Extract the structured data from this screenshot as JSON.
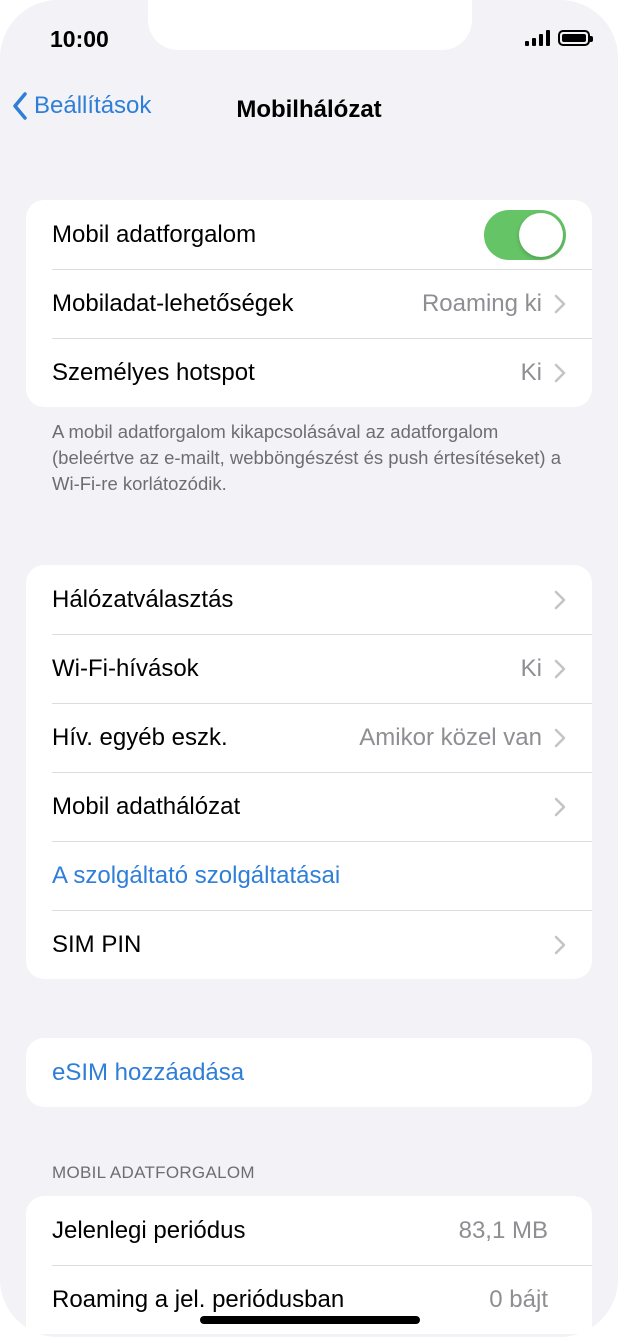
{
  "status_bar": {
    "time": "10:00"
  },
  "nav": {
    "back_label": "Beállítások",
    "title": "Mobilhálózat"
  },
  "group1": {
    "rows": [
      {
        "label": "Mobil adatforgalom",
        "toggle_on": true
      },
      {
        "label": "Mobiladat-lehetőségek",
        "value": "Roaming ki"
      },
      {
        "label": "Személyes hotspot",
        "value": "Ki"
      }
    ],
    "footnote": "A mobil adatforgalom kikapcsolásával az adatforgalom (beleértve az e-mailt, webböngészést és push értesítéseket) a Wi-Fi-re korlátozódik."
  },
  "group2": {
    "rows": [
      {
        "label": "Hálózatválasztás",
        "value": ""
      },
      {
        "label": "Wi-Fi-hívások",
        "value": "Ki"
      },
      {
        "label": "Hív. egyéb eszk.",
        "value": "Amikor közel van"
      },
      {
        "label": "Mobil adathálózat",
        "value": ""
      },
      {
        "label": "A szolgáltató szolgáltatásai"
      },
      {
        "label": "SIM PIN",
        "value": ""
      }
    ]
  },
  "group3": {
    "esim_label": "eSIM hozzáadása"
  },
  "usage": {
    "header": "MOBIL ADATFORGALOM",
    "rows": [
      {
        "label": "Jelenlegi periódus",
        "value": "83,1 MB"
      },
      {
        "label": "Roaming a jel. periódusban",
        "value": "0 bájt"
      }
    ]
  },
  "colors": {
    "accent": "#2f7ed8",
    "toggle_on": "#65c466",
    "background": "#f2f2f7"
  }
}
